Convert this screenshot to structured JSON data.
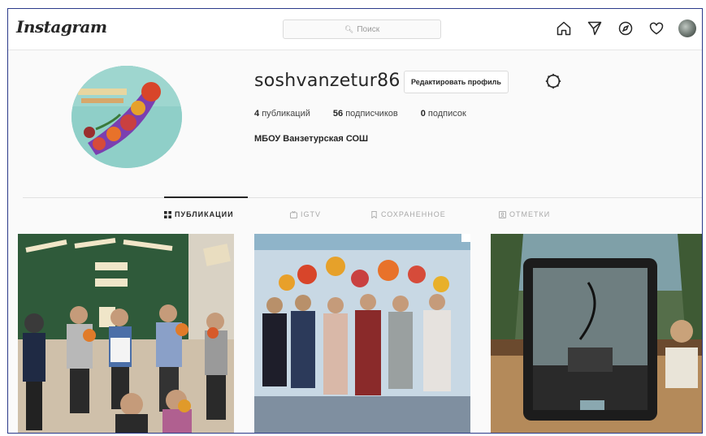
{
  "header": {
    "logo": "Instagram",
    "search_placeholder": "Поиск"
  },
  "nav_icons": [
    "home-icon",
    "direct-icon",
    "explore-icon",
    "activity-heart-icon",
    "profile-avatar"
  ],
  "profile": {
    "username": "soshvanzetur86",
    "edit_button": "Редактировать профиль",
    "stats": {
      "posts_count": "4",
      "posts_label": "публикаций",
      "followers_count": "56",
      "followers_label": "подписчиков",
      "following_count": "0",
      "following_label": "подписок"
    },
    "full_name": "МБОУ Ванзетурская СОШ"
  },
  "tabs": [
    {
      "label": "ПУБЛИКАЦИИ",
      "active": true
    },
    {
      "label": "IGTV",
      "active": false
    },
    {
      "label": "СОХРАНЕННОЕ",
      "active": false
    },
    {
      "label": "ОТМЕТКИ",
      "active": false
    }
  ],
  "colors": {
    "frame_border": "#2b3a8a",
    "chalkboard": "#2f5a3a"
  }
}
